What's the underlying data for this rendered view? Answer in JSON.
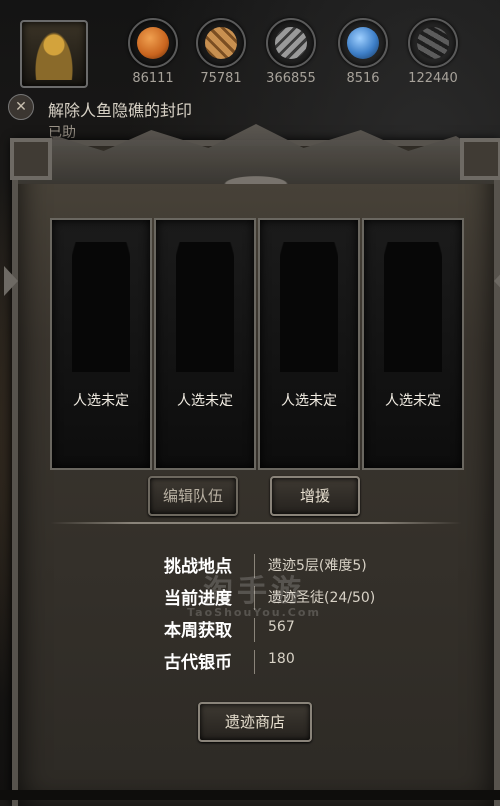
{
  "resources": [
    {
      "icon": "orange-orb-icon",
      "value": "86111",
      "color": "#c8641e"
    },
    {
      "icon": "bronze-scroll-icon",
      "value": "75781",
      "color": "#b47a3a"
    },
    {
      "icon": "grey-feather-icon",
      "value": "366855",
      "color": "#7d7d7d"
    },
    {
      "icon": "blue-crystal-icon",
      "value": "8516",
      "color": "#3e7fc8"
    },
    {
      "icon": "dark-claw-icon",
      "value": "122440",
      "color": "#4a4a4a"
    }
  ],
  "quest": {
    "title": "解除人鱼隐礁的封印",
    "subtitle": "已助"
  },
  "slots": [
    {
      "label": "人选未定"
    },
    {
      "label": "人选未定"
    },
    {
      "label": "人选未定"
    },
    {
      "label": "人选未定"
    }
  ],
  "buttons": {
    "edit_team": "编辑队伍",
    "reinforce": "增援",
    "ruins_shop": "遗迹商店"
  },
  "info": [
    {
      "label": "挑战地点",
      "value": "遗迹5层(难度5)"
    },
    {
      "label": "当前进度",
      "value": "遗迹圣徒(24/50)"
    },
    {
      "label": "本周获取",
      "value": "567"
    },
    {
      "label": "古代银币",
      "value": "180"
    }
  ],
  "watermark": {
    "main": "淘手游",
    "sub": "TaoShouYou.Com"
  },
  "colors": {
    "panel": "#3a352e",
    "border": "#8a847a",
    "label": "#ffffff"
  }
}
